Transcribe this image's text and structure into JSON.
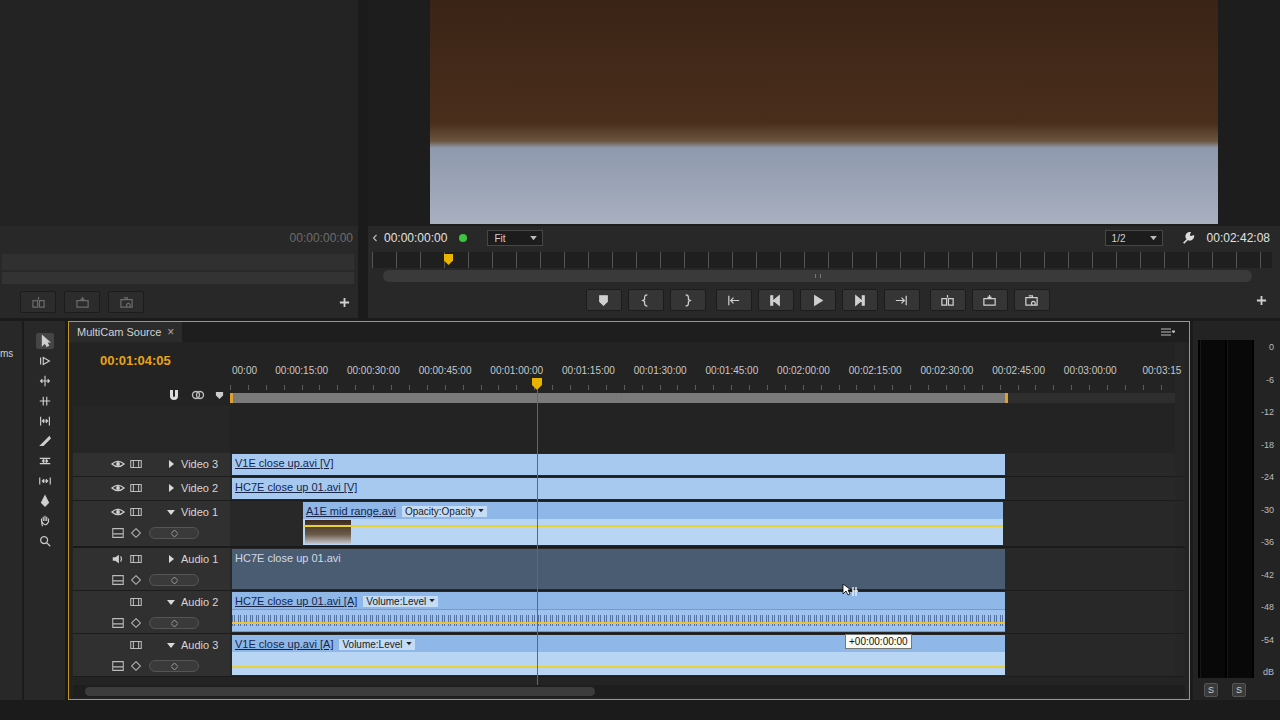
{
  "source_monitor": {
    "timecode": "00:00:00:00"
  },
  "program_monitor": {
    "timecode": "00:00:00:00",
    "zoom": "Fit",
    "resolution": "1/2",
    "duration": "00:02:42:08",
    "playhead_level": 0.084
  },
  "project_panel": {
    "label": "ms"
  },
  "tools": [
    {
      "selected": true
    },
    {
      "selected": false
    },
    {
      "selected": false
    },
    {
      "selected": false
    },
    {
      "selected": false
    },
    {
      "selected": false
    },
    {
      "selected": false
    },
    {
      "selected": false
    },
    {
      "selected": false
    },
    {
      "selected": false
    },
    {
      "selected": false
    }
  ],
  "timeline": {
    "tab": {
      "label": "MultiCam Source",
      "close": "×",
      "selected": true
    },
    "timecode": "00:01:04:05",
    "ruler": [
      "00:00",
      "00:00:15:00",
      "00:00:30:00",
      "00:00:45:00",
      "00:01:00:00",
      "00:01:15:00",
      "00:01:30:00",
      "00:01:45:00",
      "00:02:00:00",
      "00:02:15:00",
      "00:02:30:00",
      "00:02:45:00",
      "00:03:00:00",
      "00:03:15"
    ],
    "playhead_level": 0.325,
    "work_area_level": 0.823,
    "tracks": [
      {
        "name": "Video 3",
        "kind": "video",
        "output_on": true,
        "expanded": false,
        "clips": [
          {
            "label": "V1E close up.avi [V]",
            "kind": "video"
          }
        ]
      },
      {
        "name": "Video 2",
        "kind": "video",
        "output_on": true,
        "expanded": false,
        "clips": [
          {
            "label": "HC7E close up 01.avi [V]",
            "kind": "video"
          }
        ]
      },
      {
        "name": "Video 1",
        "kind": "video",
        "output_on": true,
        "expanded": true,
        "clips": [
          {
            "label": "A1E mid range.avi",
            "kind": "video-expanded",
            "effect": "Opacity:Opacity"
          }
        ]
      },
      {
        "name": "Audio 1",
        "kind": "audio",
        "output_on": true,
        "expanded": false,
        "clips": [
          {
            "label": "HC7E close up 01.avi",
            "kind": "audio-collapsed"
          }
        ]
      },
      {
        "name": "Audio 2",
        "kind": "audio",
        "output_on": false,
        "expanded": true,
        "clips": [
          {
            "label": "HC7E close up 01.avi [A]",
            "kind": "audio-wave",
            "effect": "Volume:Level"
          }
        ]
      },
      {
        "name": "Audio 3",
        "kind": "audio",
        "output_on": false,
        "expanded": true,
        "clips": [
          {
            "label": "V1E close up.avi [A]",
            "kind": "audio-expanded",
            "effect": "Volume:Level"
          }
        ]
      }
    ],
    "tooltip": "+00:00:00:00"
  },
  "meter": {
    "scale": [
      "0",
      "-6",
      "-12",
      "-18",
      "-24",
      "-30",
      "-36",
      "-42",
      "-48",
      "-54",
      "dB"
    ],
    "levels": [
      0,
      0
    ],
    "solo_buttons": [
      "S",
      "S"
    ]
  }
}
